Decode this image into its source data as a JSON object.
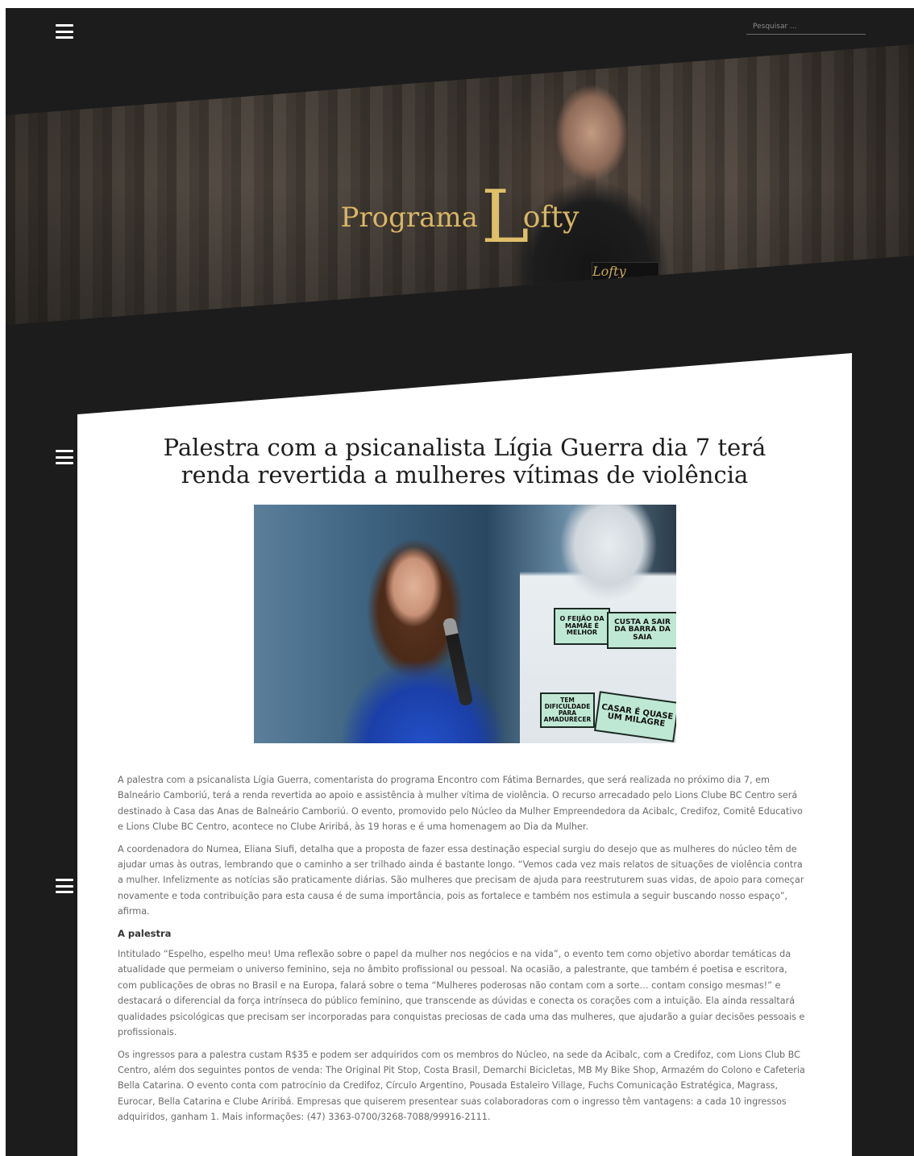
{
  "header": {
    "search_placeholder": "Pesquisar ..."
  },
  "hero": {
    "logo_word1": "Program",
    "logo_word1_end": "a",
    "logo_big_letter": "L",
    "logo_word2": "ofty",
    "mic_badge": "Lofty Lofty"
  },
  "article": {
    "title": "Palestra com a psicanalista Lígia Guerra dia 7 terá renda revertida a mulheres vítimas de violência",
    "image_tags": [
      "O FEIJÃO DA MAMÃE É MELHOR",
      "CUSTA A SAIR DA BARRA DA SAIA",
      "TEM DIFICULDADE PARA AMADURECER",
      "CASAR É QUASE UM MILAGRE"
    ],
    "paragraphs": [
      "A palestra com a psicanalista Lígia Guerra, comentarista do programa Encontro com Fátima Bernardes, que será realizada no próximo dia 7, em Balneário Camboriú, terá a renda revertida ao apoio e assistência à mulher vítima de violência. O recurso arrecadado pelo Lions Clube BC Centro será destinado à Casa das Anas de Balneário Camboriú. O evento, promovido pelo Núcleo da Mulher Empreendedora da Acibalc, Credifoz, Comitê Educativo e Lions Clube BC Centro, acontece no Clube Ariribá, às 19 horas e é uma homenagem ao Dia da Mulher.",
      "A coordenadora do Numea, Eliana Siufi, detalha que a proposta de fazer essa destinação especial surgiu do desejo que as mulheres do núcleo têm de ajudar umas às outras, lembrando que o caminho a ser trilhado ainda é bastante longo. “Vemos cada vez mais relatos de situações de violência contra a mulher. Infelizmente as notícias são praticamente diárias. São mulheres que precisam de ajuda para reestruturem suas vidas, de apoio para começar novamente e toda contribuição para esta causa é de suma importância, pois as fortalece e também nos estimula a seguir buscando nosso espaço”, afirma."
    ],
    "subheading": "A palestra",
    "paragraphs2": [
      "Intitulado “Espelho, espelho meu! Uma reflexão sobre o papel da mulher nos negócios e na vida”, o evento tem como objetivo abordar temáticas da atualidade que permeiam o universo feminino, seja no âmbito profissional ou pessoal. Na ocasião, a palestrante, que também é poetisa e escritora, com publicações de obras no Brasil e na Europa, falará sobre o tema “Mulheres poderosas não contam com a sorte… contam consigo mesmas!” e destacará o diferencial da força intrínseca do público feminino, que transcende as dúvidas e conecta os corações com a intuição. Ela ainda ressaltará qualidades psicológicas que precisam ser incorporadas para conquistas preciosas de cada uma das mulheres, que ajudarão a guiar decisões pessoais e profissionais.",
      "Os ingressos para a palestra custam R$35 e podem ser adquiridos com os membros do Núcleo, na sede da Acibalc, com a Credifoz, com Lions Club BC Centro, além dos seguintes pontos de venda: The Original Pit Stop, Costa Brasil, Demarchi Bicicletas, MB My Bike Shop, Armazém do Colono e Cafeteria Bella Catarina. O evento conta com patrocínio da Credifoz, Círculo Argentino, Pousada Estaleiro Village, Fuchs Comunicação Estratégica, Magrass, Eurocar, Bella Catarina e Clube Ariribá. Empresas que quiserem presentear suas colaboradoras com o ingresso têm vantagens: a cada 10 ingressos adquiridos, ganham 1. Mais informações: (47) 3363-0700/3268-7088/99916-2111."
    ]
  }
}
